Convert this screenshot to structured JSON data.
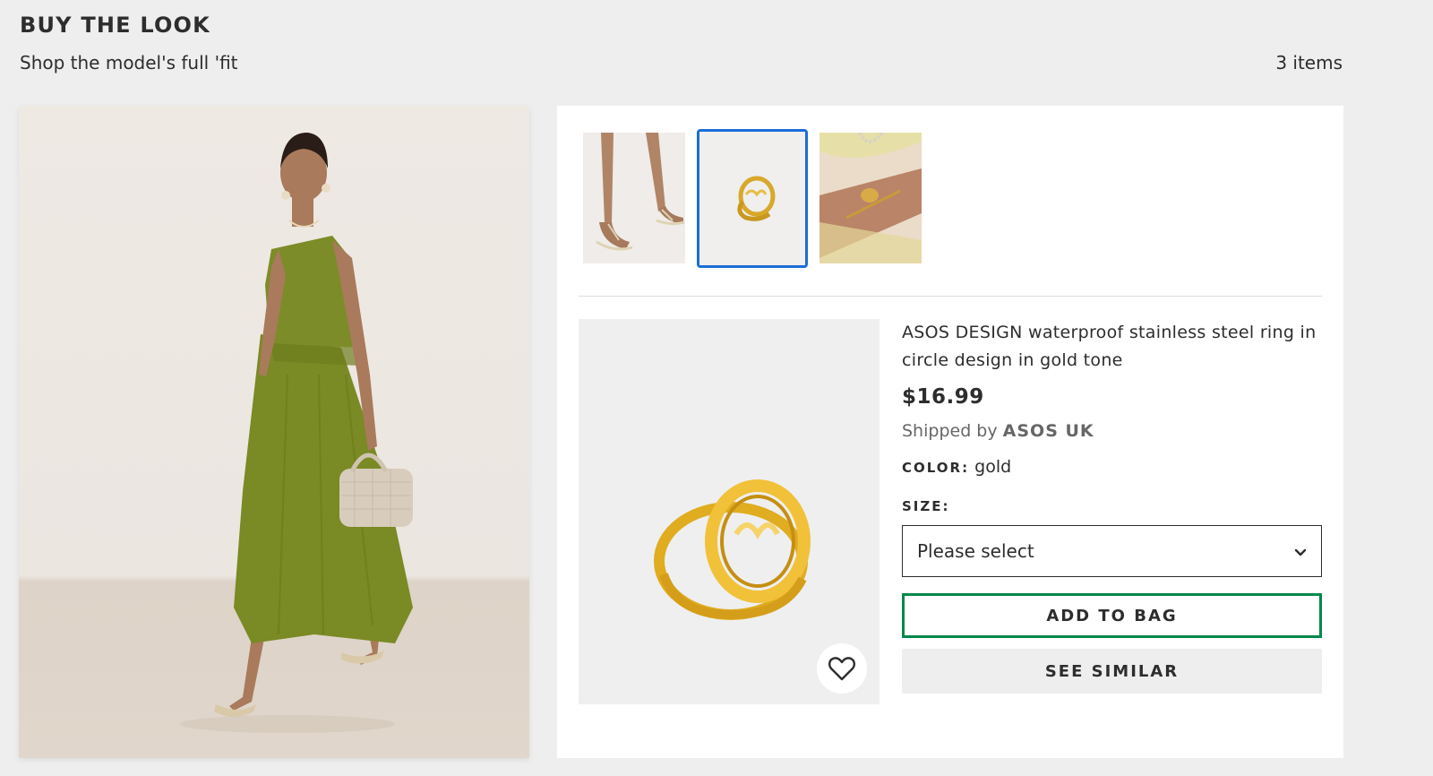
{
  "header": {
    "title": "BUY THE LOOK",
    "subtitle": "Shop the model's full 'fit",
    "items_count": "3 items"
  },
  "thumbnails": [
    {
      "name": "sandals",
      "selected": false
    },
    {
      "name": "ring",
      "selected": true
    },
    {
      "name": "bracelet",
      "selected": false
    }
  ],
  "product": {
    "name": "ASOS DESIGN waterproof stainless steel ring in circle design in gold tone",
    "price": "$16.99",
    "shipped_prefix": "Shipped by",
    "seller": "ASOS UK",
    "color_label": "COLOR:",
    "color_value": "gold",
    "size_label": "SIZE:",
    "size_placeholder": "Please select",
    "add_to_bag": "ADD TO BAG",
    "see_similar": "SEE SIMILAR"
  },
  "icons": {
    "save": "heart-icon",
    "dropdown": "chevron-down-icon"
  },
  "colors": {
    "selected_border": "#1a6ed8",
    "add_to_bag_border": "#018849",
    "background": "#eeeeee",
    "text": "#2d2d2d"
  }
}
